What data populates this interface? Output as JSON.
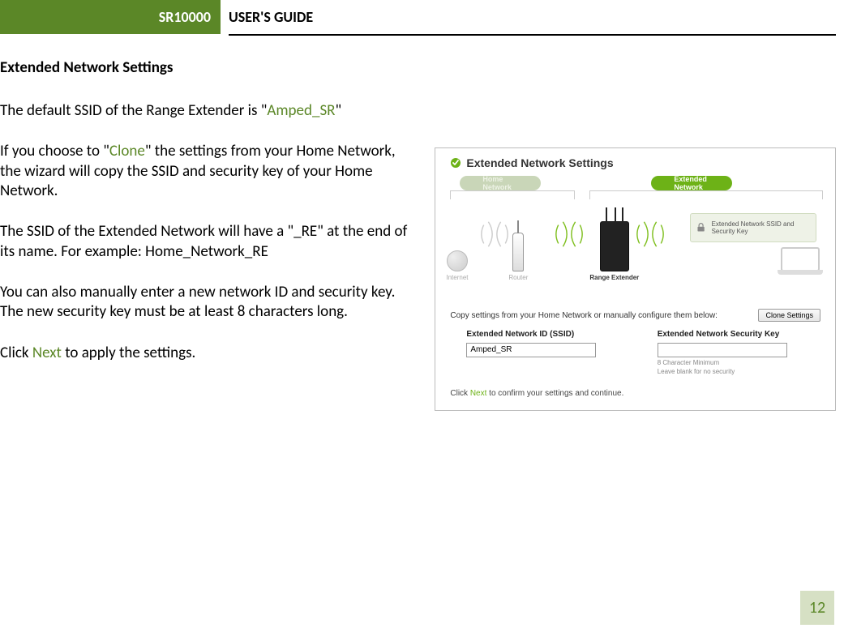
{
  "header": {
    "model": "SR10000",
    "title": "USER'S GUIDE"
  },
  "section": {
    "heading": "Extended Network Settings",
    "p1_a": "The default SSID of the Range Extender is \"",
    "p1_ssid": "Amped_SR",
    "p1_b": "\"",
    "p2_a": "If you choose to \"",
    "p2_link": "Clone",
    "p2_b": "\" the settings from your Home Network, the wizard will copy the SSID and security key of your Home Network.",
    "p3": "The SSID of the Extended Network will have a \"_RE\" at the end of its name. For example: Home_Network_RE",
    "p4": "You can also manually enter a new network ID and security key. The new security key must be at least 8 characters long.",
    "p5_a": "Click ",
    "p5_link": "Next",
    "p5_b": " to apply the settings."
  },
  "screenshot": {
    "title": "Extended Network Settings",
    "badge_home": "Home Network",
    "badge_ext": "Extended Network",
    "ext_box": "Extended Network SSID and Security Key",
    "dev_internet": "Internet",
    "dev_router": "Router",
    "dev_extender": "Range Extender",
    "copy_text": "Copy settings from your Home Network or manually configure them below:",
    "clone_btn": "Clone Settings",
    "field1_label": "Extended Network ID (SSID)",
    "field1_value": "Amped_SR",
    "field2_label": "Extended Network Security Key",
    "field2_hint1": "8 Character Minimum",
    "field2_hint2": "Leave blank for no security",
    "footer_a": "Click ",
    "footer_next": "Next",
    "footer_b": " to confirm your settings and continue."
  },
  "page_number": "12"
}
